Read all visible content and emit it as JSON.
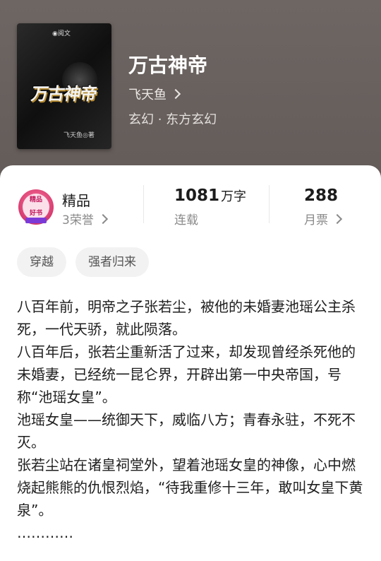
{
  "book": {
    "title": "万古神帝",
    "author": "飞天鱼",
    "genre": "玄幻 · 东方玄幻",
    "cover_title": "万古神帝",
    "cover_author": "飞天鱼◎著"
  },
  "stats": {
    "grade": "精品",
    "honors": "3荣誉",
    "word_count_num": "1081",
    "word_count_unit": "万字",
    "status": "连载",
    "monthly_tickets": "288",
    "monthly_tickets_label": "月票"
  },
  "tags": [
    "穿越",
    "强者归来"
  ],
  "description": [
    "八百年前，明帝之子张若尘，被他的未婚妻池瑶公主杀死，一代天骄，就此陨落。",
    "八百年后，张若尘重新活了过来，却发现曾经杀死他的未婚妻，已经统一昆仑界，开辟出第一中央帝国，号称“池瑶女皇”。",
    "池瑶女皇——统御天下，威临八方；青春永驻，不死不灭。",
    "张若尘站在诸皇祠堂外，望着池瑶女皇的神像，心中燃烧起熊熊的仇恨烈焰，“待我重修十三年，敢叫女皇下黄泉”。",
    "…………"
  ],
  "colors": {
    "badge": "#d53a6e",
    "text_muted": "#8a8a8a"
  }
}
